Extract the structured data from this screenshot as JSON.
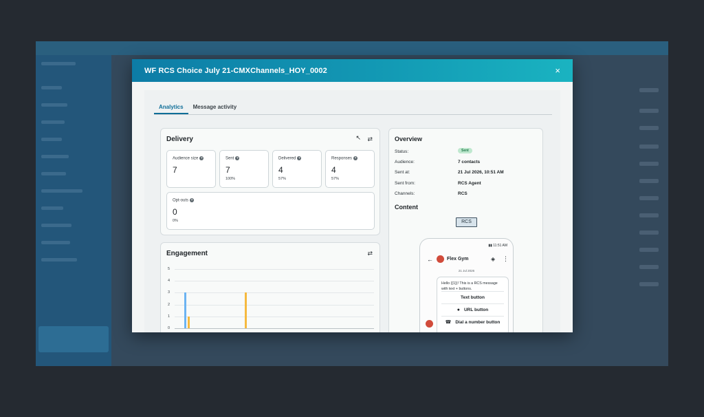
{
  "modal": {
    "title": "WF RCS Choice July 21-CMXChannels_HOY_0002",
    "close_glyph": "×"
  },
  "tabs": [
    "Analytics",
    "Message activity"
  ],
  "delivery": {
    "title": "Delivery",
    "stats": [
      {
        "label": "Audience size",
        "value": "7",
        "sub": ""
      },
      {
        "label": "Sent",
        "value": "7",
        "sub": "100%"
      },
      {
        "label": "Delivered",
        "value": "4",
        "sub": "57%"
      },
      {
        "label": "Responses",
        "value": "4",
        "sub": "57%"
      },
      {
        "label": "Opt-outs",
        "value": "0",
        "sub": "0%"
      }
    ]
  },
  "engagement": {
    "title": "Engagement",
    "y_ticks": [
      "5",
      "4",
      "3",
      "2",
      "1",
      "0"
    ]
  },
  "chart_data": {
    "type": "bar",
    "ylim": [
      0,
      5
    ],
    "series": [
      {
        "color": "#6cb4f2",
        "values": [
          3
        ]
      },
      {
        "color": "#f5b93e",
        "values": [
          1,
          3
        ]
      }
    ]
  },
  "overview": {
    "title": "Overview",
    "rows": [
      {
        "label": "Status:",
        "value": "Sent"
      },
      {
        "label": "Audience:",
        "value": "7 contacts"
      },
      {
        "label": "Sent at:",
        "value": "21 Jul 2026, 10:51 AM"
      },
      {
        "label": "Sent from:",
        "value": "RCS Agent"
      },
      {
        "label": "Channels:",
        "value": "RCS"
      }
    ],
    "content_title": "Content",
    "channel_tag": "RCS"
  },
  "phone": {
    "time": "11:51 AM",
    "agent_name": "Flex Gym",
    "date": "21 Jul 2026",
    "message": "Hello {{1}}! This is a RCS message with text + buttons.",
    "buttons": [
      "Text button",
      "URL button",
      "Dial a number button"
    ]
  },
  "colors": {
    "accent": "#0f6e98",
    "header_start": "#0d7ca6",
    "header_end": "#1ab3c1",
    "status_green": "#20794a"
  }
}
